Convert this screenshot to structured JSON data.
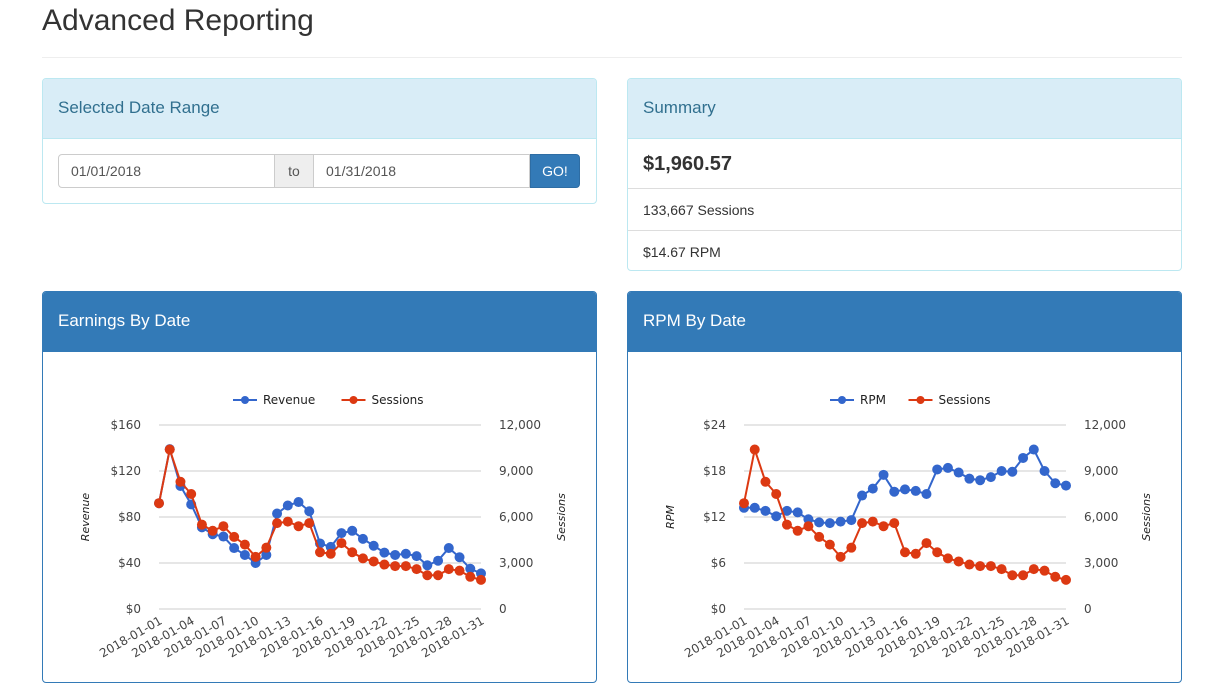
{
  "page": {
    "title": "Advanced Reporting"
  },
  "date_range": {
    "heading": "Selected Date Range",
    "start_value": "01/01/2018",
    "separator": "to",
    "end_value": "01/31/2018",
    "go_label": "GO!"
  },
  "summary": {
    "heading": "Summary",
    "total": "$1,960.57",
    "sessions": "133,667 Sessions",
    "rpm": "$14.67 RPM"
  },
  "colors": {
    "blue": "#3366cc",
    "red": "#dc3912"
  },
  "chart_data": [
    {
      "panel_title": "Earnings By Date",
      "type": "line",
      "title": "",
      "x": [
        "2018-01-01",
        "2018-01-02",
        "2018-01-03",
        "2018-01-04",
        "2018-01-05",
        "2018-01-06",
        "2018-01-07",
        "2018-01-08",
        "2018-01-09",
        "2018-01-10",
        "2018-01-11",
        "2018-01-12",
        "2018-01-13",
        "2018-01-14",
        "2018-01-15",
        "2018-01-16",
        "2018-01-17",
        "2018-01-18",
        "2018-01-19",
        "2018-01-20",
        "2018-01-21",
        "2018-01-22",
        "2018-01-23",
        "2018-01-24",
        "2018-01-25",
        "2018-01-26",
        "2018-01-27",
        "2018-01-28",
        "2018-01-29",
        "2018-01-30",
        "2018-01-31"
      ],
      "x_tick_labels": [
        "2018-01-01",
        "2018-01-04",
        "2018-01-07",
        "2018-01-10",
        "2018-01-13",
        "2018-01-16",
        "2018-01-19",
        "2018-01-22",
        "2018-01-25",
        "2018-01-28",
        "2018-01-31"
      ],
      "series": [
        {
          "name": "Revenue",
          "axis": "left",
          "color": "#3366cc",
          "values": [
            92,
            139,
            107,
            91,
            71,
            65,
            63,
            53,
            47,
            40,
            47,
            83,
            90,
            93,
            85,
            57,
            54,
            66,
            68,
            61,
            55,
            49,
            47,
            48,
            46,
            38,
            42,
            53,
            45,
            35,
            31
          ]
        },
        {
          "name": "Sessions",
          "axis": "right",
          "color": "#dc3912",
          "values": [
            6900,
            10400,
            8300,
            7500,
            5500,
            5100,
            5400,
            4700,
            4200,
            3400,
            4000,
            5600,
            5700,
            5400,
            5600,
            3700,
            3600,
            4300,
            3700,
            3300,
            3100,
            2900,
            2800,
            2800,
            2600,
            2200,
            2200,
            2600,
            2500,
            2100,
            1900
          ]
        }
      ],
      "ylabel": "Revenue",
      "ylabel_right": "Sessions",
      "ylim": [
        0,
        160
      ],
      "ylim_right": [
        0,
        12000
      ],
      "y_ticks": [
        "$0",
        "$40",
        "$80",
        "$120",
        "$160"
      ],
      "y_ticks_right": [
        "0",
        "3,000",
        "6,000",
        "9,000",
        "12,000"
      ],
      "grid": true,
      "legend": "top"
    },
    {
      "panel_title": "RPM By Date",
      "type": "line",
      "title": "",
      "x": [
        "2018-01-01",
        "2018-01-02",
        "2018-01-03",
        "2018-01-04",
        "2018-01-05",
        "2018-01-06",
        "2018-01-07",
        "2018-01-08",
        "2018-01-09",
        "2018-01-10",
        "2018-01-11",
        "2018-01-12",
        "2018-01-13",
        "2018-01-14",
        "2018-01-15",
        "2018-01-16",
        "2018-01-17",
        "2018-01-18",
        "2018-01-19",
        "2018-01-20",
        "2018-01-21",
        "2018-01-22",
        "2018-01-23",
        "2018-01-24",
        "2018-01-25",
        "2018-01-26",
        "2018-01-27",
        "2018-01-28",
        "2018-01-29",
        "2018-01-30",
        "2018-01-31"
      ],
      "x_tick_labels": [
        "2018-01-01",
        "2018-01-04",
        "2018-01-07",
        "2018-01-10",
        "2018-01-13",
        "2018-01-16",
        "2018-01-19",
        "2018-01-22",
        "2018-01-25",
        "2018-01-28",
        "2018-01-31"
      ],
      "series": [
        {
          "name": "RPM",
          "axis": "left",
          "color": "#3366cc",
          "values": [
            13.2,
            13.2,
            12.8,
            12.1,
            12.8,
            12.6,
            11.7,
            11.3,
            11.2,
            11.4,
            11.6,
            14.8,
            15.7,
            17.5,
            15.3,
            15.6,
            15.4,
            15.0,
            18.2,
            18.4,
            17.8,
            17.0,
            16.8,
            17.2,
            18.0,
            17.9,
            19.7,
            20.8,
            18.0,
            16.4,
            16.1
          ]
        },
        {
          "name": "Sessions",
          "axis": "right",
          "color": "#dc3912",
          "values": [
            6900,
            10400,
            8300,
            7500,
            5500,
            5100,
            5400,
            4700,
            4200,
            3400,
            4000,
            5600,
            5700,
            5400,
            5600,
            3700,
            3600,
            4300,
            3700,
            3300,
            3100,
            2900,
            2800,
            2800,
            2600,
            2200,
            2200,
            2600,
            2500,
            2100,
            1900
          ]
        }
      ],
      "ylabel": "RPM",
      "ylabel_right": "Sessions",
      "ylim": [
        0,
        24
      ],
      "ylim_right": [
        0,
        12000
      ],
      "y_ticks": [
        "$0",
        "$6",
        "$12",
        "$18",
        "$24"
      ],
      "y_ticks_right": [
        "0",
        "3,000",
        "6,000",
        "9,000",
        "12,000"
      ],
      "grid": true,
      "legend": "top"
    }
  ]
}
